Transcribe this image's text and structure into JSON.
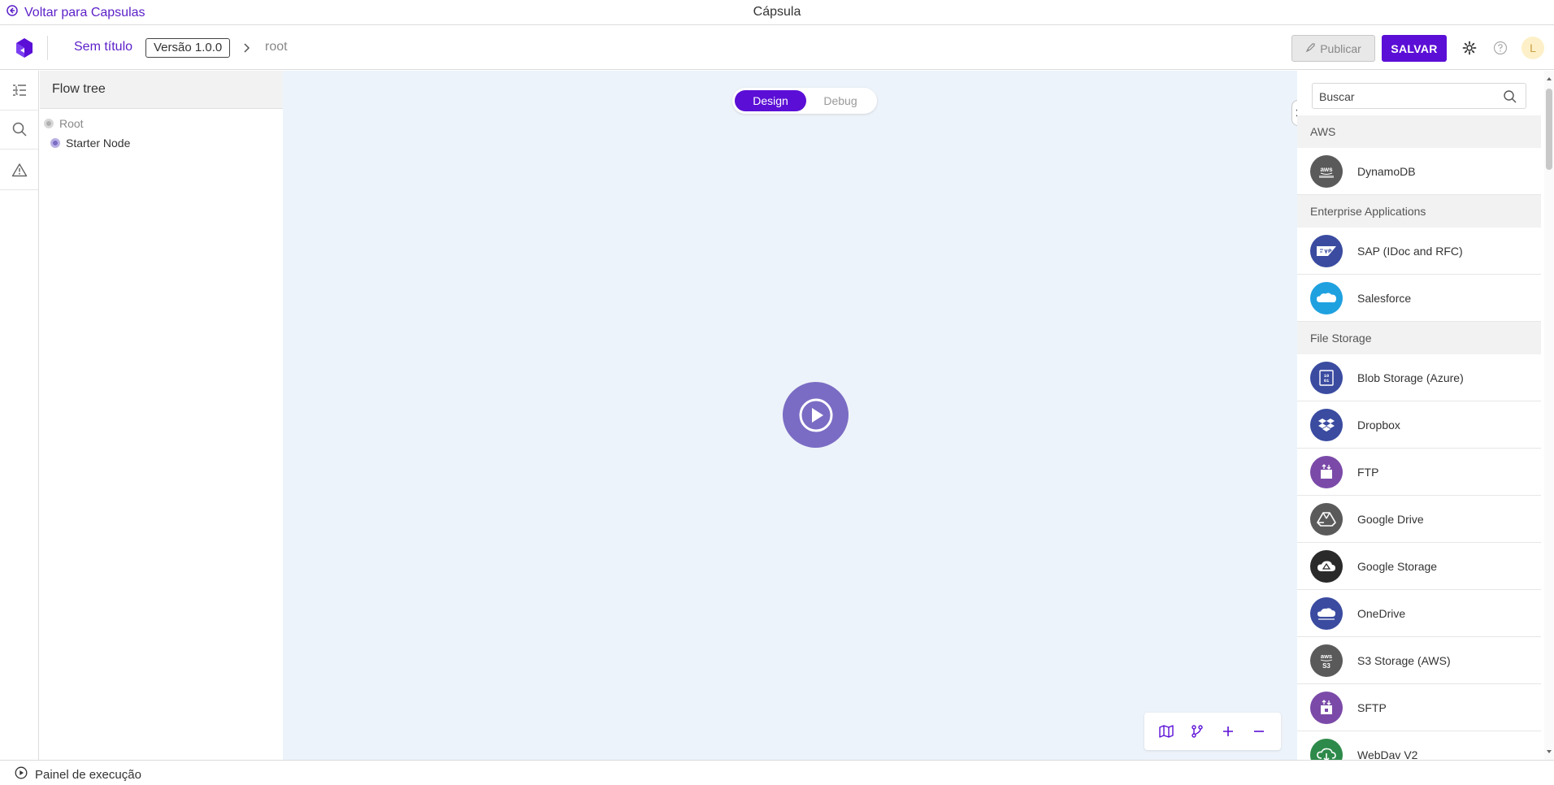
{
  "titlebar": {
    "back_label": "Voltar para Capsulas",
    "window_title": "Cápsula"
  },
  "header": {
    "doc_title": "Sem título",
    "version": "Versão 1.0.0",
    "breadcrumb_root": "root",
    "publish_label": "Publicar",
    "save_label": "SALVAR",
    "avatar_initial": "L"
  },
  "flow_tree": {
    "title": "Flow tree",
    "items": [
      {
        "label": "Root"
      },
      {
        "label": "Starter Node"
      }
    ]
  },
  "canvas": {
    "mode_design": "Design",
    "mode_debug": "Debug",
    "active_mode": "Design"
  },
  "palette": {
    "search_placeholder": "Buscar",
    "categories": [
      {
        "name": "AWS",
        "connectors": [
          {
            "label": "DynamoDB",
            "icon": "dynamodb-icon",
            "color": "#5a5a5a"
          }
        ]
      },
      {
        "name": "Enterprise Applications",
        "connectors": [
          {
            "label": "SAP (IDoc and RFC)",
            "icon": "sap-icon",
            "color": "#3a4ba0"
          },
          {
            "label": "Salesforce",
            "icon": "salesforce-icon",
            "color": "#1fa1e0"
          }
        ]
      },
      {
        "name": "File Storage",
        "connectors": [
          {
            "label": "Blob Storage (Azure)",
            "icon": "blob-storage-icon",
            "color": "#3a4ba0"
          },
          {
            "label": "Dropbox",
            "icon": "dropbox-icon",
            "color": "#3a4ba0"
          },
          {
            "label": "FTP",
            "icon": "ftp-icon",
            "color": "#7b4aa8"
          },
          {
            "label": "Google Drive",
            "icon": "google-drive-icon",
            "color": "#5a5a5a"
          },
          {
            "label": "Google Storage",
            "icon": "google-storage-icon",
            "color": "#2a2a2a"
          },
          {
            "label": "OneDrive",
            "icon": "onedrive-icon",
            "color": "#3a4ba0"
          },
          {
            "label": "S3 Storage (AWS)",
            "icon": "s3-icon",
            "color": "#5a5a5a"
          },
          {
            "label": "SFTP",
            "icon": "sftp-icon",
            "color": "#7b4aa8"
          },
          {
            "label": "WebDav V2",
            "icon": "webdav-icon",
            "color": "#2e8a4a"
          }
        ]
      }
    ]
  },
  "footer": {
    "execution_panel_label": "Painel de execução"
  },
  "colors": {
    "accent": "#5b0fd6",
    "canvas_bg": "#edf3fa",
    "start_node": "#7a6cc4"
  }
}
